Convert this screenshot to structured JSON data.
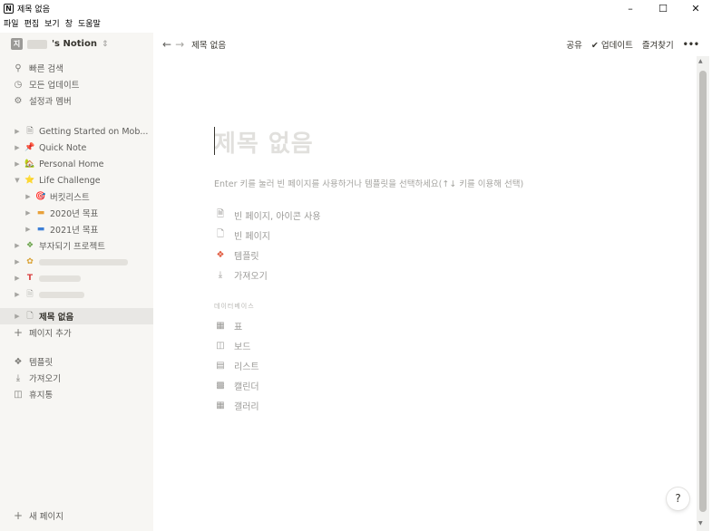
{
  "window": {
    "title": "제목 없음",
    "minimize": "–",
    "maximize": "☐",
    "close": "✕"
  },
  "menubar": [
    "파일",
    "편집",
    "보기",
    "창",
    "도움말"
  ],
  "sidebar": {
    "workspace_initial": "지",
    "workspace_name": "'s Notion",
    "workspace_chevron": "⇕",
    "top_items": [
      {
        "icon": "search-icon",
        "label": "빠른 검색"
      },
      {
        "icon": "clock-icon",
        "label": "모든 업데이트"
      },
      {
        "icon": "gear-icon",
        "label": "설정과 멤버"
      }
    ],
    "pages": [
      {
        "label": "Getting Started on Mob...",
        "emoji": "🗎",
        "toggle": "▶"
      },
      {
        "label": "Quick Note",
        "emoji": "📌",
        "toggle": "▶"
      },
      {
        "label": "Personal Home",
        "emoji": "🏡",
        "toggle": "▶"
      },
      {
        "label": "Life Challenge",
        "emoji": "⭐",
        "toggle": "▼"
      },
      {
        "label": "버킷리스트",
        "emoji": "🎯",
        "toggle": "▶"
      },
      {
        "label": "2020년 목표",
        "emoji": "▬",
        "toggle": "▶"
      },
      {
        "label": "2021년 목표",
        "emoji": "▬",
        "toggle": "▶"
      },
      {
        "label": "부자되기 프로젝트",
        "emoji": "❖",
        "toggle": "▶"
      },
      {
        "label": "",
        "emoji": "✿",
        "toggle": "▶"
      },
      {
        "label": "",
        "emoji": "T",
        "toggle": "▶"
      },
      {
        "label": "",
        "emoji": "🗎",
        "toggle": "▶"
      },
      {
        "label": "제목 없음",
        "emoji": "🗋",
        "toggle": "▶"
      }
    ],
    "add_page": "페이지 추가",
    "bottom_items": [
      {
        "icon": "template-icon",
        "label": "템플릿"
      },
      {
        "icon": "import-icon",
        "label": "가져오기"
      },
      {
        "icon": "trash-icon",
        "label": "휴지통"
      }
    ],
    "new_page": "새 페이지"
  },
  "topbar": {
    "back": "←",
    "forward": "→",
    "breadcrumb": "제목 없음",
    "share": "공유",
    "updates": "업데이트",
    "favorite": "즐겨찾기",
    "more": "•••"
  },
  "content": {
    "title_placeholder": "제목 없음",
    "hint": "Enter 키를 눌러 빈 페이지를 사용하거나 템플릿을 선택하세요(↑↓ 키를 이용해 선택)",
    "options": [
      {
        "icon": "page-icon",
        "label": "빈 페이지, 아이콘 사용"
      },
      {
        "icon": "page-icon",
        "label": "빈 페이지"
      },
      {
        "icon": "template-icon",
        "label": "템플릿"
      },
      {
        "icon": "import-icon",
        "label": "가져오기"
      }
    ],
    "database_label": "데이터베이스",
    "databases": [
      {
        "icon": "table-icon",
        "label": "표"
      },
      {
        "icon": "board-icon",
        "label": "보드"
      },
      {
        "icon": "list-icon",
        "label": "리스트"
      },
      {
        "icon": "calendar-icon",
        "label": "캘린더"
      },
      {
        "icon": "gallery-icon",
        "label": "갤러리"
      }
    ]
  },
  "help": "?"
}
